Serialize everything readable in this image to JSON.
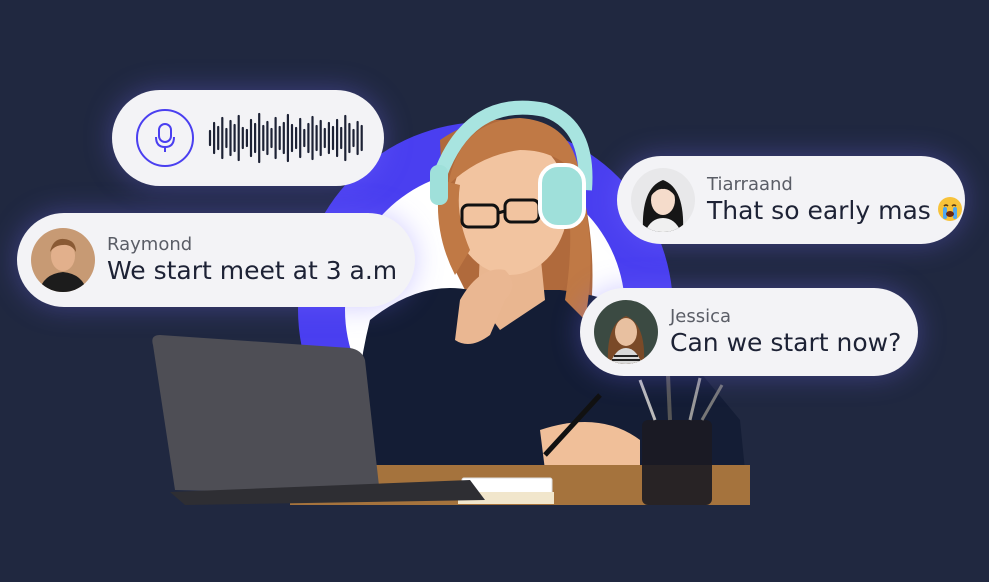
{
  "colors": {
    "background": "#202840",
    "accent": "#4a3ff0",
    "bubble": "#f3f3f6"
  },
  "voice_message": {
    "icon": "microphone-icon",
    "waveform": "audio-waveform-icon"
  },
  "messages": [
    {
      "sender": "Raymond",
      "text": "We start meet at 3 a.m"
    },
    {
      "sender": "Tiarraand",
      "text": "That so early mas",
      "emoji": "crying-face-emoji"
    },
    {
      "sender": "Jessica",
      "text": "Can we start now?"
    }
  ]
}
